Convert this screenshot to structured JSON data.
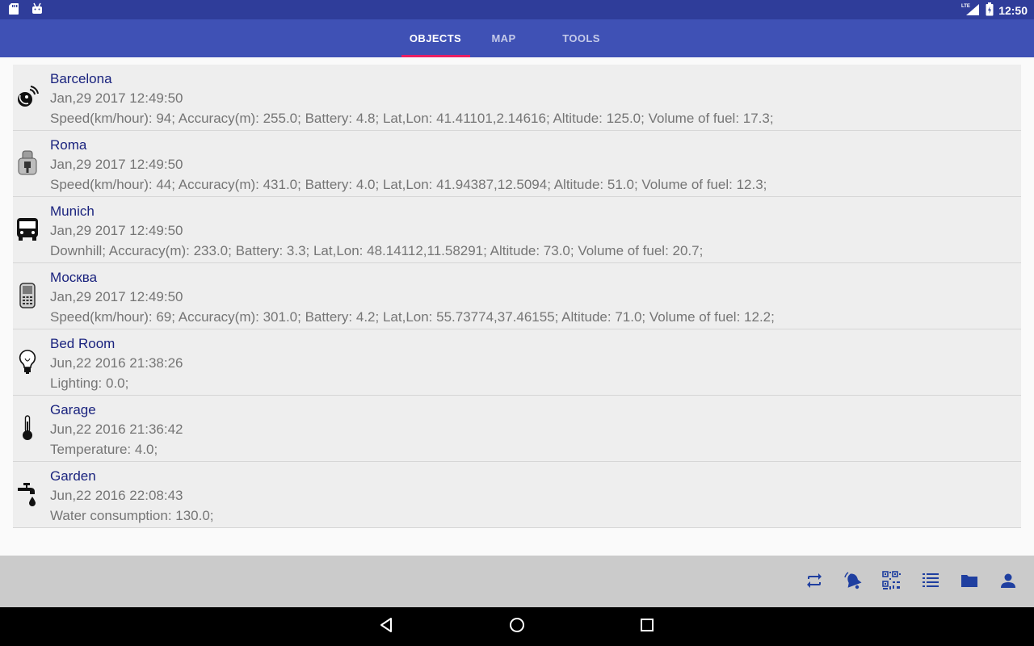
{
  "status_bar": {
    "time": "12:50",
    "network": "LTE",
    "left_icons": [
      "sd-card-icon",
      "android-icon"
    ],
    "right_icons": [
      "lte-signal-icon",
      "battery-icon"
    ]
  },
  "tabs": [
    {
      "label": "OBJECTS",
      "active": true
    },
    {
      "label": "MAP",
      "active": false
    },
    {
      "label": "TOOLS",
      "active": false
    }
  ],
  "objects": [
    {
      "name": "Barcelona",
      "time": "Jan,29 2017 12:49:50",
      "info": "Speed(km/hour): 94; Accuracy(m): 255.0; Battery: 4.8; Lat,Lon: 41.41101,2.14616; Altitude: 125.0; Volume of fuel: 17.3;",
      "icon": "satellite-icon"
    },
    {
      "name": "Roma",
      "time": "Jan,29 2017 12:49:50",
      "info": "Speed(km/hour): 44; Accuracy(m): 431.0; Battery: 4.0; Lat,Lon: 41.94387,12.5094; Altitude: 51.0; Volume of fuel: 12.3;",
      "icon": "gps-tracker-icon"
    },
    {
      "name": "Munich",
      "time": "Jan,29 2017 12:49:50",
      "info": "Downhill; Accuracy(m): 233.0; Battery: 3.3; Lat,Lon: 48.14112,11.58291; Altitude: 73.0; Volume of fuel: 20.7;",
      "icon": "bus-icon"
    },
    {
      "name": "Москва",
      "time": "Jan,29 2017 12:49:50",
      "info": "Speed(km/hour): 69; Accuracy(m): 301.0; Battery: 4.2; Lat,Lon: 55.73774,37.46155; Altitude: 71.0; Volume of fuel: 12.2;",
      "icon": "mobile-phone-icon"
    },
    {
      "name": "Bed Room",
      "time": "Jun,22 2016 21:38:26",
      "info": "Lighting: 0.0;",
      "icon": "light-bulb-icon"
    },
    {
      "name": "Garage",
      "time": "Jun,22 2016 21:36:42",
      "info": "Temperature: 4.0;",
      "icon": "thermometer-icon"
    },
    {
      "name": "Garden",
      "time": "Jun,22 2016 22:08:43",
      "info": "Water consumption: 130.0;",
      "icon": "water-tap-icon"
    }
  ],
  "bottom_actions": [
    "refresh-icon",
    "alarm-bell-icon",
    "qr-code-icon",
    "list-icon",
    "folder-icon",
    "account-icon"
  ],
  "nav_buttons": [
    "back-icon",
    "home-icon",
    "recents-icon"
  ],
  "colors": {
    "primary": "#3f51b5",
    "status_bar": "#2f3d9a",
    "accent": "#e91e63",
    "action_icon": "#1f3fa0",
    "name_text": "#1a237e"
  }
}
